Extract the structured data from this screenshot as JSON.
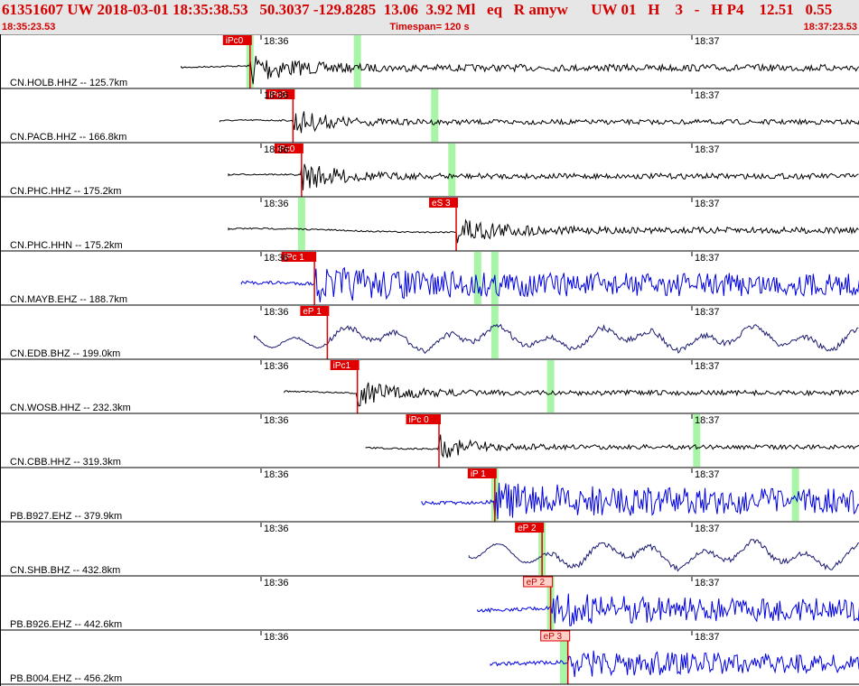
{
  "header": {
    "title": "61351607 UW 2018-03-01 18:35:38.53   50.3037 -129.8285  13.06  3.92 Ml   eq   R amyw      UW 01   H    3   -   H P4    12.51   0.55",
    "start_time": "18:35:23.53",
    "timespan": "Timespan= 120 s",
    "end_time": "18:37:23.53"
  },
  "colors": {
    "title": "#d40000",
    "pick_auto": "#e00000",
    "pick_manual_fill": "#ffd0c8",
    "pick_manual_border": "#e00000",
    "green_marker": "#a8f5a8",
    "wave_black": "#000000",
    "wave_blue": "#0000e0",
    "wave_navy": "#1a1a70"
  },
  "time_labels": {
    "first": "18:36",
    "second": "18:37"
  },
  "panels": [
    {
      "label": "CN.HOLB.HHZ -- 125.7km",
      "pick": "iPc0",
      "pick_style": "auto",
      "color": "black",
      "style": "spike",
      "start": 0.21,
      "pick_pos": 0.29,
      "greens": [
        0.29,
        0.415
      ],
      "amp": 0.7
    },
    {
      "label": "CN.PACB.HHZ -- 166.8km",
      "pick": "iPc0",
      "pick_style": "auto",
      "color": "black",
      "style": "spike",
      "start": 0.255,
      "pick_pos": 0.34,
      "greens": [
        0.505
      ],
      "amp": 0.5
    },
    {
      "label": "CN.PHC.HHZ -- 175.2km",
      "pick": "iPc0",
      "pick_style": "auto",
      "color": "black",
      "style": "spike",
      "start": 0.265,
      "pick_pos": 0.35,
      "greens": [
        0.525
      ],
      "amp": 0.55
    },
    {
      "label": "CN.PHC.HHN -- 175.2km",
      "pick": "eS 3",
      "pick_style": "auto",
      "color": "black",
      "style": "spike",
      "start": 0.265,
      "pick_pos": 0.53,
      "greens": [
        0.35
      ],
      "amp": 0.65
    },
    {
      "label": "CN.MAYB.EHZ -- 188.7km",
      "pick": "iPc 1",
      "pick_style": "auto",
      "color": "blue",
      "style": "noise",
      "start": 0.28,
      "pick_pos": 0.365,
      "greens": [
        0.555,
        0.575
      ],
      "amp": 0.75
    },
    {
      "label": "CN.EDB.BHZ -- 199.0km",
      "pick": "eP 1",
      "pick_style": "auto",
      "color": "navy",
      "style": "wavy",
      "start": 0.295,
      "pick_pos": 0.38,
      "greens": [
        0.575
      ],
      "amp": 0.45
    },
    {
      "label": "CN.WOSB.HHZ -- 232.3km",
      "pick": "iPc1",
      "pick_style": "auto",
      "color": "black",
      "style": "spike",
      "start": 0.33,
      "pick_pos": 0.415,
      "greens": [
        0.64
      ],
      "amp": 0.5
    },
    {
      "label": "CN.CBB.HHZ -- 319.3km",
      "pick": "iPc 0",
      "pick_style": "auto",
      "color": "black",
      "style": "spike",
      "start": 0.425,
      "pick_pos": 0.51,
      "greens": [
        0.81
      ],
      "amp": 0.45
    },
    {
      "label": "PB.B927.EHZ -- 379.9km",
      "pick": "iP 1",
      "pick_style": "auto",
      "color": "blue",
      "style": "noise",
      "start": 0.49,
      "pick_pos": 0.575,
      "greens": [
        0.575,
        0.925
      ],
      "amp": 0.8
    },
    {
      "label": "CN.SHB.BHZ -- 432.8km",
      "pick": "eP 2",
      "pick_style": "auto",
      "color": "navy",
      "style": "wavy",
      "start": 0.545,
      "pick_pos": 0.63,
      "greens": [
        0.63
      ],
      "amp": 0.5
    },
    {
      "label": "PB.B926.EHZ -- 442.6km",
      "pick": "eP 2",
      "pick_style": "manual",
      "color": "blue",
      "style": "noise",
      "start": 0.555,
      "pick_pos": 0.64,
      "greens": [
        0.64
      ],
      "amp": 0.7
    },
    {
      "label": "PB.B004.EHZ -- 456.2km",
      "pick": "eP 3",
      "pick_style": "manual",
      "color": "blue",
      "style": "noise",
      "start": 0.57,
      "pick_pos": 0.66,
      "greens": [
        0.655
      ],
      "amp": 0.6
    }
  ]
}
